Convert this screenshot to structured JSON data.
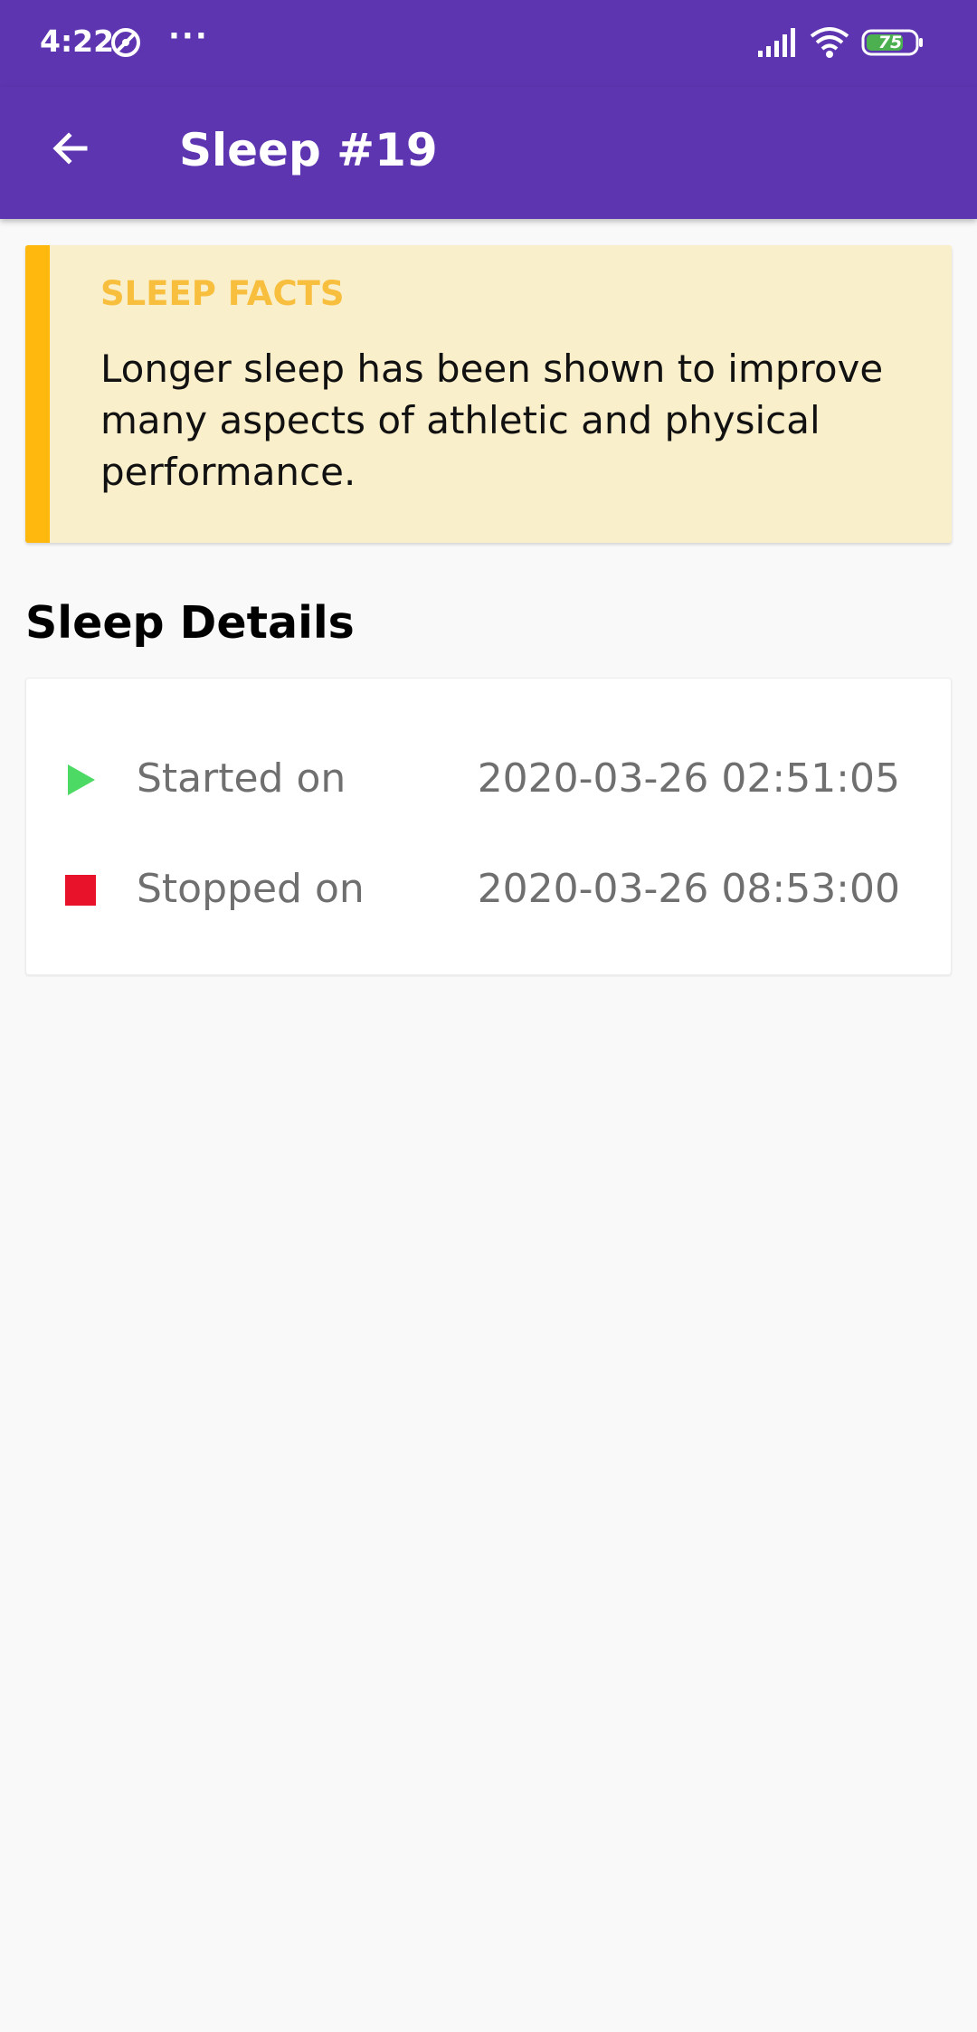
{
  "status_bar": {
    "time": "4:22",
    "overflow": "···",
    "battery_level": "75",
    "icons": [
      "dnd-icon",
      "signal-icon",
      "wifi-icon",
      "battery-icon"
    ]
  },
  "app_bar": {
    "title": "Sleep #19",
    "back_icon": "arrow-back-icon"
  },
  "sleep_facts": {
    "label": "SLEEP FACTS",
    "text": "Longer sleep has been shown to improve many aspects of athletic and physical performance."
  },
  "sleep_details": {
    "heading": "Sleep Details",
    "started": {
      "label": "Started on",
      "value": "2020-03-26 02:51:05",
      "icon": "play-icon"
    },
    "stopped": {
      "label": "Stopped on",
      "value": "2020-03-26 08:53:00",
      "icon": "stop-icon"
    }
  },
  "colors": {
    "primary": "#5e35b1",
    "facts_accent": "#ffb80d",
    "facts_background": "#faefcb",
    "start_green": "#4cd964",
    "stop_red": "#e8132a"
  }
}
